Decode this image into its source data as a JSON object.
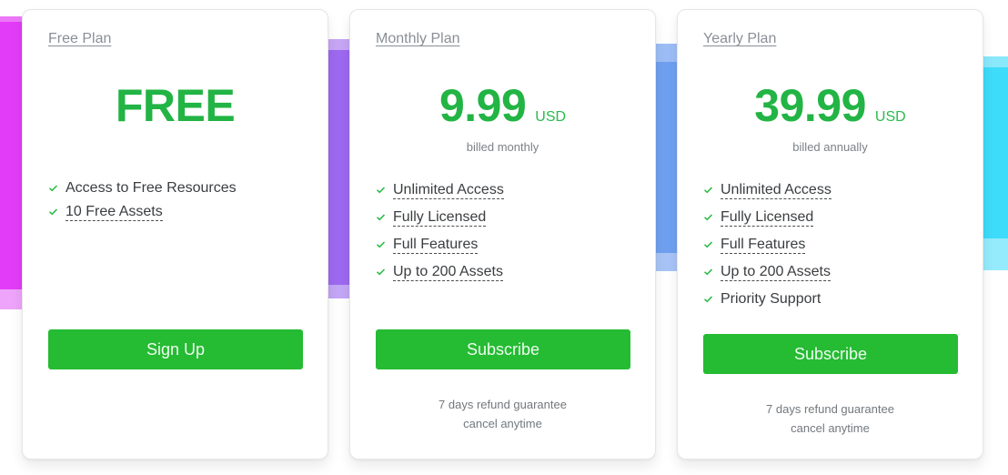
{
  "colors": {
    "accent_green": "#25bb33",
    "price_green": "#22b444",
    "band_pink": "#e23cf8",
    "band_purple": "#9d69f0",
    "band_blue": "#6fa0f0",
    "band_cyan": "#3ddcfa"
  },
  "icons": {
    "feature_check": "check-icon"
  },
  "plans": [
    {
      "name": "Free Plan",
      "price": "FREE",
      "currency": "",
      "billing": "",
      "features": [
        {
          "label": "Access to Free Resources",
          "dashed": false
        },
        {
          "label": "10 Free Assets",
          "dashed": true
        }
      ],
      "button_label": "Sign Up",
      "guarantee_line1": "",
      "guarantee_line2": ""
    },
    {
      "name": "Monthly Plan",
      "price": "9.99",
      "currency": "USD",
      "billing": "billed monthly",
      "features": [
        {
          "label": "Unlimited Access",
          "dashed": true
        },
        {
          "label": "Fully Licensed",
          "dashed": true
        },
        {
          "label": "Full Features",
          "dashed": true
        },
        {
          "label": "Up to 200 Assets",
          "dashed": true
        }
      ],
      "button_label": "Subscribe",
      "guarantee_line1": "7 days refund guarantee",
      "guarantee_line2": "cancel anytime"
    },
    {
      "name": "Yearly Plan",
      "price": "39.99",
      "currency": "USD",
      "billing": "billed annually",
      "features": [
        {
          "label": "Unlimited Access",
          "dashed": true
        },
        {
          "label": "Fully Licensed",
          "dashed": true
        },
        {
          "label": "Full Features",
          "dashed": true
        },
        {
          "label": "Up to 200 Assets",
          "dashed": true
        },
        {
          "label": "Priority Support",
          "dashed": false
        }
      ],
      "button_label": "Subscribe",
      "guarantee_line1": "7 days refund guarantee",
      "guarantee_line2": "cancel anytime"
    }
  ]
}
